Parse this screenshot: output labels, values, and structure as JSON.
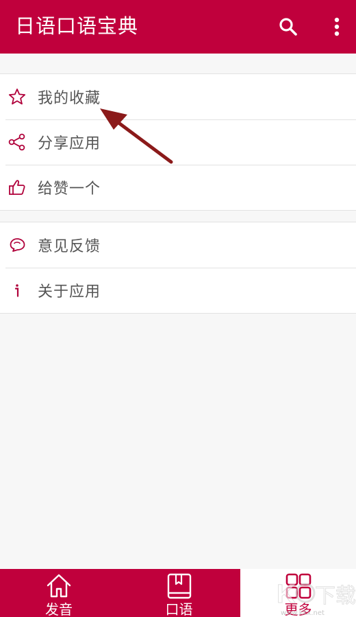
{
  "appbar": {
    "title": "日语口语宝典",
    "search_icon": "search-icon",
    "more_icon": "more-vertical-icon"
  },
  "menu": {
    "group1": [
      {
        "label": "我的收藏",
        "icon": "star-outline-icon"
      },
      {
        "label": "分享应用",
        "icon": "share-icon"
      },
      {
        "label": "给赞一个",
        "icon": "thumbs-up-icon"
      }
    ],
    "group2": [
      {
        "label": "意见反馈",
        "icon": "chat-bubble-icon"
      },
      {
        "label": "关于应用",
        "icon": "info-icon"
      }
    ]
  },
  "bottom_nav": [
    {
      "label": "发音",
      "icon": "home-icon",
      "active": false
    },
    {
      "label": "口语",
      "icon": "book-icon",
      "active": false
    },
    {
      "label": "更多",
      "icon": "grid-icon",
      "active": true
    }
  ],
  "watermark": {
    "text": "KK下载",
    "sub": "www.kkx.net"
  },
  "colors": {
    "primary": "#c0003c",
    "background": "#f7f7f7",
    "text": "#555555",
    "annotation_arrow": "#8b1a1a"
  }
}
